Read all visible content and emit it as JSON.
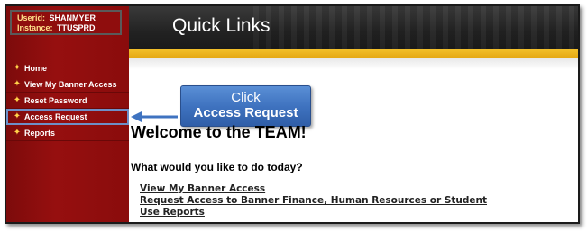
{
  "user": {
    "userid_label": "Userid:",
    "userid_value": "SHANMYER",
    "instance_label": "Instance:",
    "instance_value": "TTUSPRD"
  },
  "sidebar": {
    "items": [
      {
        "label": "Home"
      },
      {
        "label": "View My Banner Access"
      },
      {
        "label": "Reset Password"
      },
      {
        "label": "Access Request"
      },
      {
        "label": "Reports"
      }
    ]
  },
  "header": {
    "title": "Quick Links"
  },
  "callout": {
    "line1": "Click",
    "line2": "Access Request"
  },
  "main": {
    "welcome": "Welcome to the TEAM!",
    "question": "What would you like to do today?",
    "links": [
      "View My Banner Access",
      "Request Access to Banner Finance, Human Resources or Student",
      "Use Reports"
    ]
  },
  "colors": {
    "sidebar": "#8a0c0c",
    "accent_gold": "#f2bf2a",
    "callout_blue": "#3f73c0",
    "highlight_outline": "#6e8fc7"
  },
  "icons": {
    "nav_bullet": "star-bullet-icon",
    "pointer": "left-arrow-icon"
  }
}
